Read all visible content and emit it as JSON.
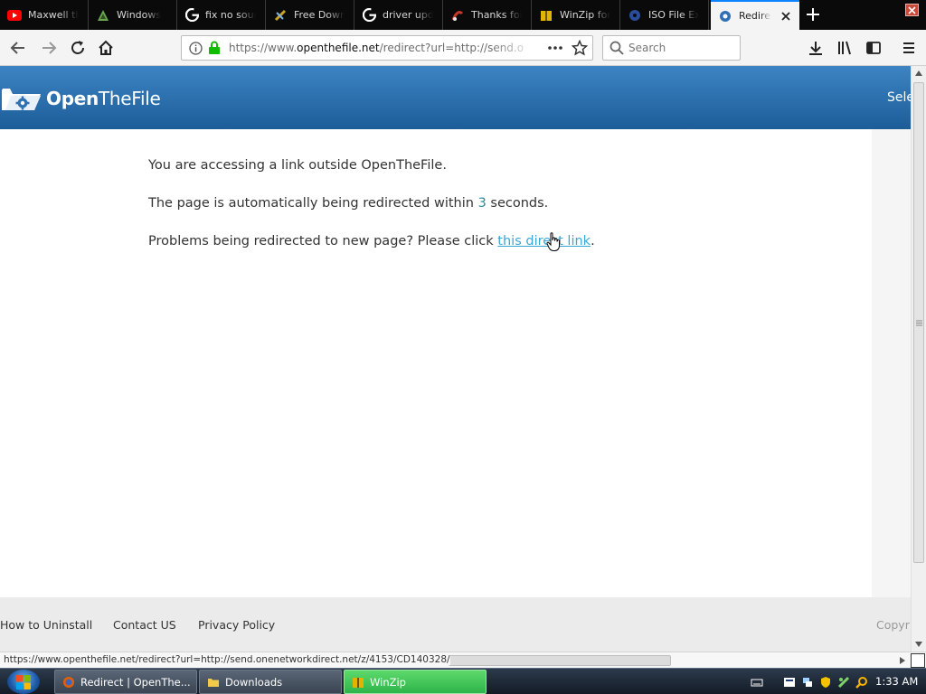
{
  "browser": {
    "tabs": [
      {
        "label": "Maxwell th",
        "icon": "youtube-icon",
        "color": "#ff0000"
      },
      {
        "label": "Windows",
        "icon": "windows-site-icon",
        "color": "#6aa84f"
      },
      {
        "label": "fix no sour",
        "icon": "google-icon",
        "color": "#4285f4"
      },
      {
        "label": "Free Down",
        "icon": "download-site-icon",
        "color": "#c9a227"
      },
      {
        "label": "driver upd",
        "icon": "google-icon",
        "color": "#4285f4"
      },
      {
        "label": "Thanks for",
        "icon": "thanks-site-icon",
        "color": "#c0392b"
      },
      {
        "label": "WinZip for",
        "icon": "winzip-icon",
        "color": "#e0b400"
      },
      {
        "label": "ISO File Ext",
        "icon": "iso-site-icon",
        "color": "#2a4d9a"
      },
      {
        "label": "Redirect",
        "icon": "openthefile-icon",
        "color": "#2f6fb5",
        "active": true
      }
    ],
    "url_prefix": "https://www.",
    "url_domain": "openthefile.net",
    "url_rest": "/redirect?url=http://send.o",
    "search_placeholder": "Search",
    "status_url": "https://www.openthefile.net/redirect?url=http://send.onenetworkdirect.net/z/4153/CD140328/"
  },
  "site": {
    "logo_bold": "Open",
    "logo_rest": "TheFile",
    "header_select": "Select",
    "message_line1": "You are accessing a link outside OpenTheFile.",
    "message_line2_prefix": "The page is automatically being redirected within ",
    "countdown": "3",
    "message_line2_suffix": " seconds.",
    "message_line3_prefix": "Problems being redirected to new page? Please click ",
    "direct_link": "this direct link",
    "message_line3_suffix": ".",
    "footer_links": [
      "How to Uninstall",
      "Contact US",
      "Privacy Policy"
    ],
    "copyright": "Copyright"
  },
  "taskbar": {
    "buttons": [
      {
        "label": "Redirect | OpenThe...",
        "icon": "firefox-icon"
      },
      {
        "label": "Downloads",
        "icon": "folder-icon"
      },
      {
        "label": "WinZip",
        "icon": "winzip-icon"
      }
    ],
    "clock": "1:33 AM"
  },
  "colors": {
    "header_blue": "#2f72b3",
    "link": "#3aa6d6",
    "countdown": "#2a8ca0",
    "tab_accent": "#0a84ff",
    "winzip_green": "#2db44a"
  }
}
